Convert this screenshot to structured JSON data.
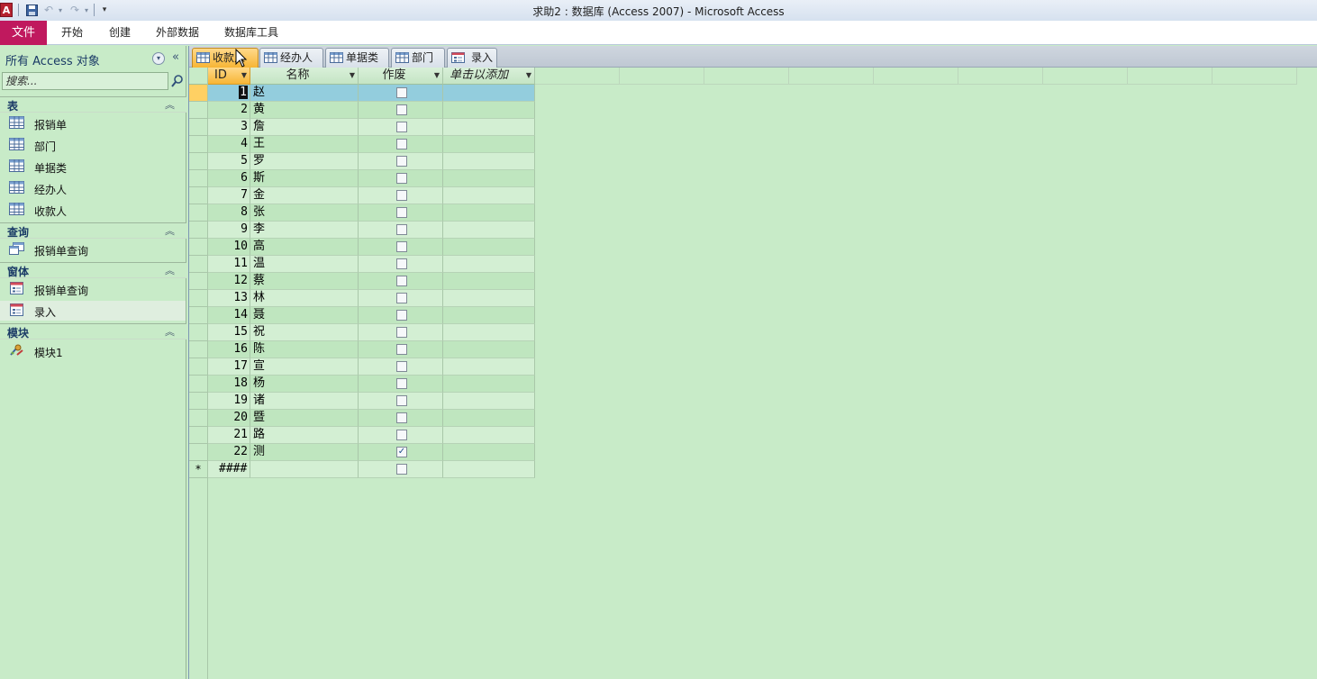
{
  "window": {
    "title": "求助2 : 数据库 (Access 2007)  -  Microsoft Access",
    "app_icon": "A"
  },
  "ribbon": {
    "file": "文件",
    "tabs": [
      "开始",
      "创建",
      "外部数据",
      "数据库工具"
    ]
  },
  "nav": {
    "title": "所有 Access 对象",
    "search_placeholder": "搜索...",
    "groups": {
      "tables": {
        "label": "表",
        "items": [
          "报销单",
          "部门",
          "单据类",
          "经办人",
          "收款人"
        ]
      },
      "queries": {
        "label": "查询",
        "items": [
          "报销单查询"
        ]
      },
      "forms": {
        "label": "窗体",
        "items": [
          "报销单查询",
          "录入"
        ]
      },
      "modules": {
        "label": "模块",
        "items": [
          "模块1"
        ]
      }
    }
  },
  "doc_tabs": [
    "收款人",
    "经办人",
    "单据类",
    "部门",
    "录入"
  ],
  "datasheet": {
    "columns": {
      "id": "ID",
      "name": "名称",
      "void": "作废",
      "add": "单击以添加"
    },
    "new_row_marker": "*",
    "new_row_id": "####",
    "rows": [
      {
        "id": "1",
        "name": "赵",
        "void": false
      },
      {
        "id": "2",
        "name": "黄",
        "void": false
      },
      {
        "id": "3",
        "name": "詹",
        "void": false
      },
      {
        "id": "4",
        "name": "王",
        "void": false
      },
      {
        "id": "5",
        "name": "罗",
        "void": false
      },
      {
        "id": "6",
        "name": "斯",
        "void": false
      },
      {
        "id": "7",
        "name": "金",
        "void": false
      },
      {
        "id": "8",
        "name": "张",
        "void": false
      },
      {
        "id": "9",
        "name": "李",
        "void": false
      },
      {
        "id": "10",
        "name": "高",
        "void": false
      },
      {
        "id": "11",
        "name": "温",
        "void": false
      },
      {
        "id": "12",
        "name": "蔡",
        "void": false
      },
      {
        "id": "13",
        "name": "林",
        "void": false
      },
      {
        "id": "14",
        "name": "聂",
        "void": false
      },
      {
        "id": "15",
        "name": "祝",
        "void": false
      },
      {
        "id": "16",
        "name": "陈",
        "void": false
      },
      {
        "id": "17",
        "name": "宣",
        "void": false
      },
      {
        "id": "18",
        "name": "杨",
        "void": false
      },
      {
        "id": "19",
        "name": "诸",
        "void": false
      },
      {
        "id": "20",
        "name": "暨",
        "void": false
      },
      {
        "id": "21",
        "name": "路",
        "void": false
      },
      {
        "id": "22",
        "name": "测",
        "void": true
      }
    ]
  }
}
